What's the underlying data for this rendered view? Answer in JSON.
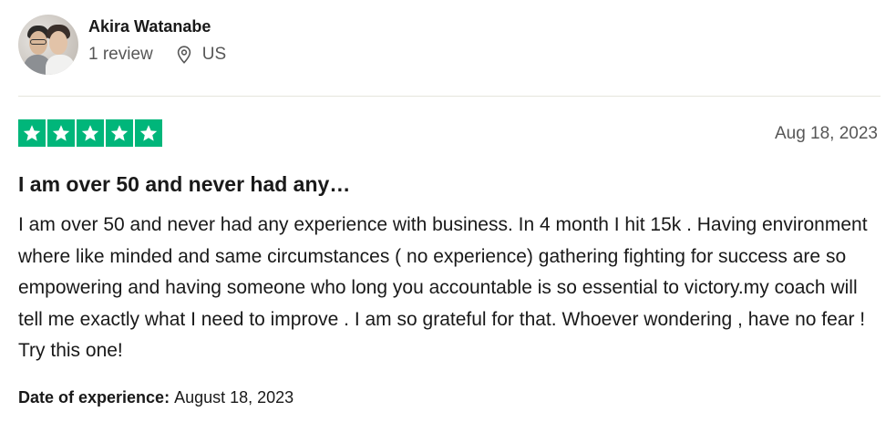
{
  "reviewer": {
    "name": "Akira Watanabe",
    "review_count": "1 review",
    "country": "US",
    "avatar_icon": "avatar-photo",
    "location_icon": "map-pin-icon"
  },
  "review": {
    "rating": 5,
    "max_rating": 5,
    "star_color": "#00b67a",
    "date": "Aug 18, 2023",
    "title": "I am over 50 and never had any…",
    "body": "I am over 50 and never had any experience with business. In 4 month I hit 15k . Having environment where like minded and same circumstances ( no experience) gathering fighting for success are so empowering and having someone who long you accountable is so essential to victory.my coach will tell me exactly what I need to improve . I am so grateful for that. Whoever wondering , have no fear ! Try this one!",
    "experience_label": "Date of experience:",
    "experience_date": "August 18, 2023"
  }
}
